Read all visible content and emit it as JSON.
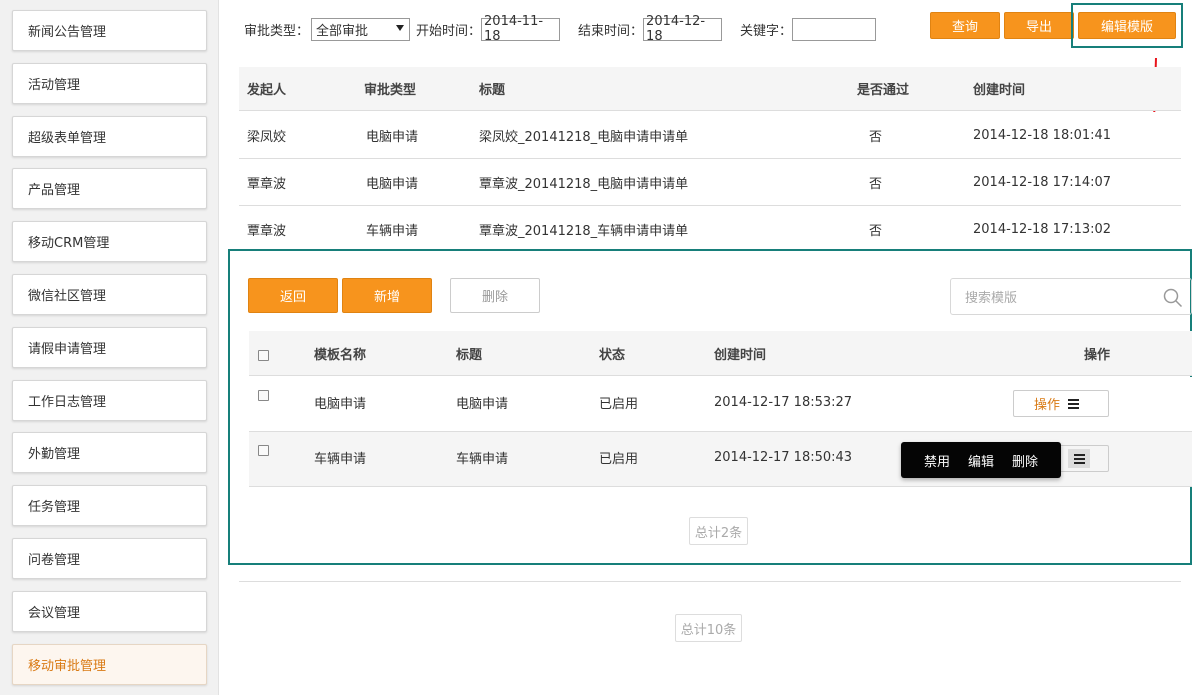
{
  "sidebar": {
    "items": [
      {
        "label": "新闻公告管理"
      },
      {
        "label": "活动管理"
      },
      {
        "label": "超级表单管理"
      },
      {
        "label": "产品管理"
      },
      {
        "label": "移动CRM管理"
      },
      {
        "label": "微信社区管理"
      },
      {
        "label": "请假申请管理"
      },
      {
        "label": "工作日志管理"
      },
      {
        "label": "外勤管理"
      },
      {
        "label": "任务管理"
      },
      {
        "label": "问卷管理"
      },
      {
        "label": "会议管理"
      },
      {
        "label": "移动审批管理"
      }
    ],
    "active_index": 12
  },
  "filter": {
    "type_label": "审批类型：",
    "type_value": "全部审批",
    "start_label": "开始时间：",
    "start_value": "2014-11-18",
    "end_label": "结束时间：",
    "end_value": "2014-12-18",
    "keyword_label": "关键字：",
    "keyword_value": ""
  },
  "toolbar": {
    "query_label": "查询",
    "export_label": "导出",
    "edit_template_label": "编辑模版"
  },
  "table": {
    "columns": [
      "发起人",
      "审批类型",
      "标题",
      "是否通过",
      "创建时间"
    ],
    "rows": [
      [
        "梁凤姣",
        "电脑申请",
        "梁凤姣_20141218_电脑申请申请单",
        "否",
        "2014-12-18 18:01:41"
      ],
      [
        "覃章波",
        "电脑申请",
        "覃章波_20141218_电脑申请申请单",
        "否",
        "2014-12-18 17:14:07"
      ],
      [
        "覃章波",
        "车辆申请",
        "覃章波_20141218_车辆申请申请单",
        "否",
        "2014-12-18 17:13:02"
      ]
    ],
    "total_label": "总计10条"
  },
  "panel": {
    "back_label": "返回",
    "add_label": "新增",
    "delete_label": "删除",
    "search_placeholder": "搜索模版",
    "columns": [
      "模板名称",
      "标题",
      "状态",
      "创建时间",
      "操作"
    ],
    "rows": [
      {
        "name": "电脑申请",
        "title": "电脑申请",
        "status": "已启用",
        "created": "2014-12-17 18:53:27",
        "op_label": "操作"
      },
      {
        "name": "车辆申请",
        "title": "车辆申请",
        "status": "已启用",
        "created": "2014-12-17 18:50:43",
        "op_label": ""
      }
    ],
    "popup": {
      "disable_label": "禁用",
      "edit_label": "编辑",
      "delete_label": "删除"
    },
    "total_label": "总计2条"
  },
  "colors": {
    "accent": "#f7941d",
    "highlight": "#177f7a",
    "arrow": "#e8141b"
  }
}
